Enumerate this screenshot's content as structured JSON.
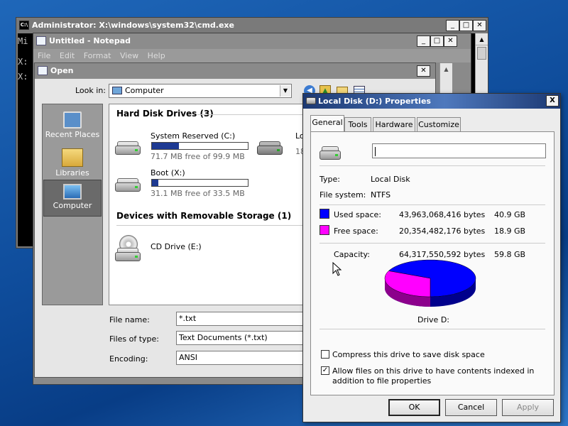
{
  "cmd": {
    "title": "Administrator: X:\\windows\\system32\\cmd.exe",
    "lines": [
      "Mi",
      "X:",
      "X:"
    ]
  },
  "notepad": {
    "title": "Untitled - Notepad",
    "menu": [
      "File",
      "Edit",
      "Format",
      "View",
      "Help"
    ]
  },
  "open_dialog": {
    "title": "Open",
    "look_in_label": "Look in:",
    "look_in_value": "Computer",
    "places": [
      {
        "label": "Recent Places",
        "icon": "recent-places-icon"
      },
      {
        "label": "Libraries",
        "icon": "libraries-icon"
      },
      {
        "label": "Computer",
        "icon": "computer-icon"
      }
    ],
    "hdd_group": "Hard Disk Drives (3)",
    "drives": [
      {
        "name": "System Reserved (C:)",
        "free": "71.7 MB free of 99.9 MB",
        "used_fraction": 0.28
      },
      {
        "name": "Boot (X:)",
        "free": "31.1 MB free of 33.5 MB",
        "used_fraction": 0.07
      }
    ],
    "partial_drive": {
      "name": "Lo",
      "free": "18"
    },
    "removable_group": "Devices with Removable Storage (1)",
    "cd_drive": "CD Drive (E:)",
    "filename_label": "File name:",
    "filename_value": "*.txt",
    "filetype_label": "Files of type:",
    "filetype_value": "Text Documents (*.txt)",
    "encoding_label": "Encoding:",
    "encoding_value": "ANSI"
  },
  "props": {
    "title": "Local Disk (D:) Properties",
    "close": "X",
    "tabs": [
      "General",
      "Tools",
      "Hardware",
      "Customize"
    ],
    "active_tab": "General",
    "name_value": "",
    "type_label": "Type:",
    "type_value": "Local Disk",
    "fs_label": "File system:",
    "fs_value": "NTFS",
    "used_label": "Used space:",
    "used_bytes": "43,963,068,416 bytes",
    "used_gb": "40.9 GB",
    "free_label": "Free space:",
    "free_bytes": "20,354,482,176 bytes",
    "free_gb": "18.9 GB",
    "capacity_label": "Capacity:",
    "capacity_bytes": "64,317,550,592 bytes",
    "capacity_gb": "59.8 GB",
    "drive_label": "Drive D:",
    "used_color": "#0000ff",
    "free_color": "#ff00ff",
    "used_fraction": 0.684,
    "compress_label": "Compress this drive to save disk space",
    "compress_checked": false,
    "index_label": "Allow files on this drive to have contents indexed in addition to file properties",
    "index_checked": true,
    "ok": "OK",
    "cancel": "Cancel",
    "apply": "Apply"
  }
}
